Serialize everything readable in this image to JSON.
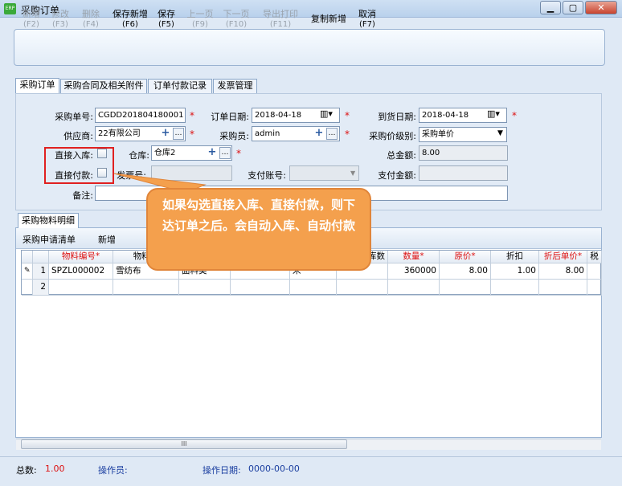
{
  "window": {
    "title": "采购订单",
    "icon": "app-icon",
    "blurred_tabs": [
      "",
      "",
      "",
      "",
      "",
      "",
      "",
      "",
      "",
      "",
      ""
    ]
  },
  "toolbar": [
    {
      "label": "新增",
      "key": "(F2)",
      "enabled": false
    },
    {
      "label": "修改",
      "key": "(F3)",
      "enabled": false
    },
    {
      "label": "删除",
      "key": "(F4)",
      "enabled": false
    },
    {
      "label": "保存新增",
      "key": "(F6)",
      "enabled": true
    },
    {
      "label": "保存",
      "key": "(F5)",
      "enabled": true
    },
    {
      "label": "上一页",
      "key": "(F9)",
      "enabled": false
    },
    {
      "label": "下一页",
      "key": "(F10)",
      "enabled": false
    },
    {
      "label": "导出打印",
      "key": "(F11)",
      "enabled": false
    },
    {
      "label": "复制新增",
      "key": "",
      "enabled": true
    },
    {
      "label": "取消",
      "key": "(F7)",
      "enabled": true
    }
  ],
  "tabs": [
    "采购订单",
    "采购合同及相关附件",
    "订单付款记录",
    "发票管理"
  ],
  "form": {
    "order_no_label": "采购单号:",
    "order_no": "CGDD201804180001",
    "order_date_label": "订单日期:",
    "order_date": "2018-04-18",
    "arrival_date_label": "到货日期:",
    "arrival_date": "2018-04-18",
    "supplier_label": "供应商:",
    "supplier": "22有限公司",
    "buyer_label": "采购员:",
    "buyer": "admin",
    "price_level_label": "采购价级别:",
    "price_level": "采购单价",
    "direct_stock_label": "直接入库:",
    "warehouse_label": "仓库:",
    "warehouse": "仓库2",
    "total_label": "总金额:",
    "total": "8.00",
    "direct_pay_label": "直接付款:",
    "invoice_label": "发票号:",
    "pay_account_label": "支付账号:",
    "pay_amount_label": "支付金额:",
    "remark_label": "备注:"
  },
  "callout": "如果勾选直接入库、直接付款，则下达订单之后。会自动入库、自动付款",
  "detail": {
    "tab": "采购物料明细",
    "toolbar": [
      "采购申请清单",
      "新增"
    ],
    "columns": [
      "",
      "",
      "物料编号*",
      "物料名",
      "",
      "",
      "",
      "库数",
      "数量*",
      "原价*",
      "折扣",
      "折后单价*",
      "税"
    ],
    "rows": [
      {
        "no": "1",
        "code": "SPZL000002",
        "name": "雪纺布",
        "category": "面料类",
        "unit": "米",
        "qty": "360000",
        "price": "8.00",
        "discount": "1.00",
        "net_price": "8.00"
      },
      {
        "no": "2"
      }
    ]
  },
  "scrollbar_grip": "III",
  "status": {
    "total_count_label": "总数:",
    "total_count": "1.00",
    "operator_label": "操作员:",
    "operator": "",
    "op_date_label": "操作日期:",
    "op_date": "0000-00-00"
  }
}
